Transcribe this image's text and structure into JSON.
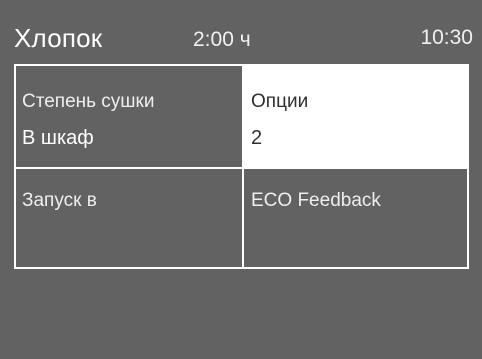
{
  "status_bar": {
    "program": "Хлопок",
    "duration": "2:00 ч",
    "clock": "10:30"
  },
  "tiles": [
    {
      "label": "Степень сушки",
      "value": "В шкаф",
      "selected": false
    },
    {
      "label": "Опции",
      "value": "2",
      "selected": true
    },
    {
      "label": "Запуск в",
      "value": "",
      "selected": false
    },
    {
      "label": "ECO Feedback",
      "value": "",
      "selected": false
    }
  ],
  "colors": {
    "background": "#626262",
    "tile_border": "#ffffff",
    "selected_tile_background": "#ffffff",
    "selected_tile_text": "#2f2f2f",
    "text": "#ffffff"
  }
}
